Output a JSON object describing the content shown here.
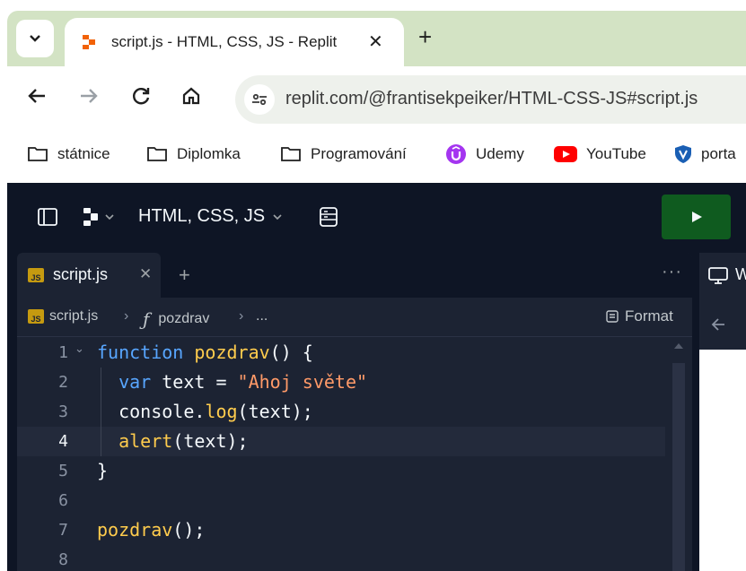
{
  "browser": {
    "tab": {
      "title": "script.js - HTML, CSS, JS - Replit",
      "favicon": "replit-icon"
    },
    "url": "replit.com/@frantisekpeiker/HTML-CSS-JS#script.js",
    "bookmarks": [
      {
        "label": "státnice",
        "icon": "folder-icon"
      },
      {
        "label": "Diplomka",
        "icon": "folder-icon"
      },
      {
        "label": "Programování",
        "icon": "folder-icon"
      },
      {
        "label": "Udemy",
        "icon": "udemy-icon"
      },
      {
        "label": "YouTube",
        "icon": "youtube-icon"
      },
      {
        "label": "porta",
        "icon": "shield-icon"
      }
    ]
  },
  "replit": {
    "project_name": "HTML, CSS, JS",
    "editor": {
      "tab_label": "script.js",
      "tab_icon_text": "JS",
      "breadcrumb": {
        "file": "script.js",
        "symbol": "pozdrav",
        "more": "..."
      },
      "format_label": "Format",
      "active_line": 4,
      "lines": [
        {
          "n": "1",
          "code": "function pozdrav() {"
        },
        {
          "n": "2",
          "code": "  var text = \"Ahoj světe\""
        },
        {
          "n": "3",
          "code": "  console.log(text);"
        },
        {
          "n": "4",
          "code": "  alert(text);"
        },
        {
          "n": "5",
          "code": "}"
        },
        {
          "n": "6",
          "code": ""
        },
        {
          "n": "7",
          "code": "pozdrav();"
        },
        {
          "n": "8",
          "code": ""
        }
      ]
    },
    "webview": {
      "tab_label_partial": "W"
    }
  },
  "colors": {
    "tabstrip": "#d3e3c4",
    "replit_bg": "#0e1525",
    "editor_bg": "#1c2333",
    "run_button": "#0f5b1f",
    "keyword": "#58a6ff",
    "function": "#ffcc4d",
    "string": "#ff9a68"
  }
}
